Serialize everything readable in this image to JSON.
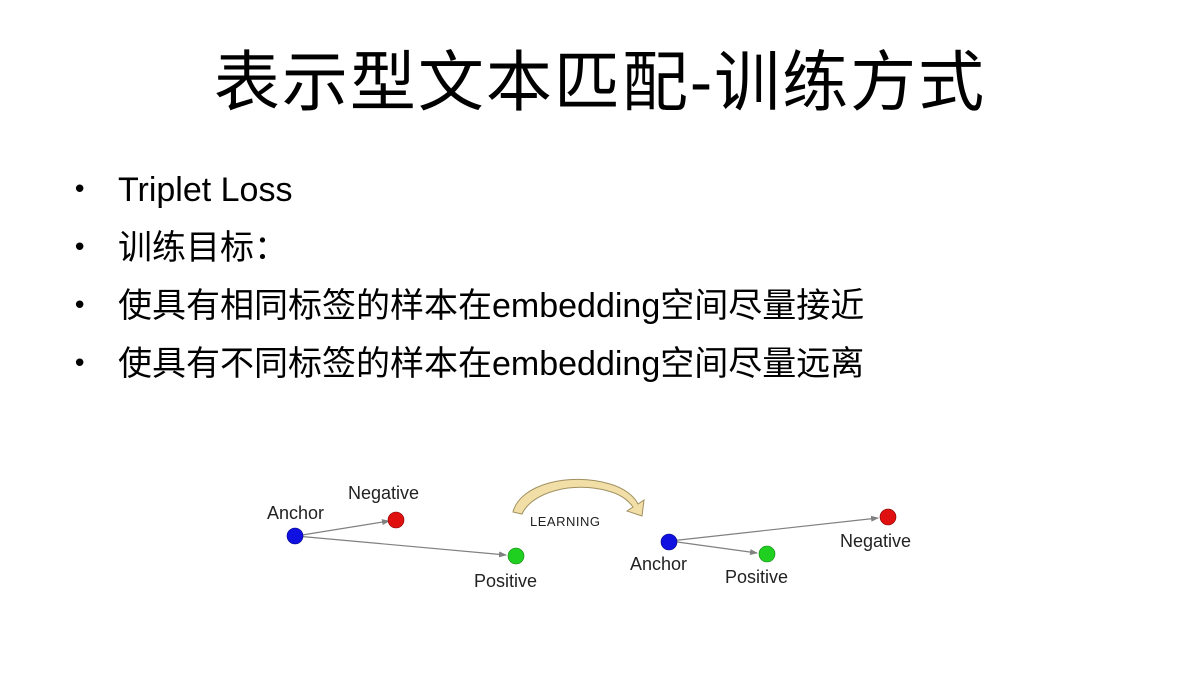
{
  "slide": {
    "title": "表示型文本匹配-训练方式",
    "bullet_marker": "•",
    "bullets": [
      "Triplet Loss",
      "训练目标：",
      "使具有相同标签的样本在embedding空间尽量接近",
      "使具有不同标签的样本在embedding空间尽量远离"
    ]
  },
  "diagram": {
    "learning_label": "LEARNING",
    "before": {
      "anchor_label": "Anchor",
      "negative_label": "Negative",
      "positive_label": "Positive"
    },
    "after": {
      "anchor_label": "Anchor",
      "negative_label": "Negative",
      "positive_label": "Positive"
    },
    "colors": {
      "anchor": "#1010e0",
      "negative": "#e01010",
      "positive": "#20d020",
      "arrow": "#808080",
      "learning_arrow": "#f2dfa8",
      "learning_arrow_outline": "#a09060"
    }
  }
}
